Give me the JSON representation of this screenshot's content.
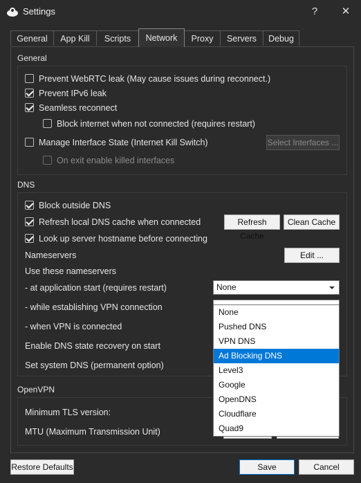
{
  "window": {
    "title": "Settings",
    "help_label": "?",
    "close_label": "✕"
  },
  "tabs": [
    {
      "label": "General"
    },
    {
      "label": "App Kill"
    },
    {
      "label": "Scripts"
    },
    {
      "label": "Network",
      "active": true
    },
    {
      "label": "Proxy"
    },
    {
      "label": "Servers"
    },
    {
      "label": "Debug"
    }
  ],
  "general": {
    "heading": "General",
    "prevent_webrtc": {
      "label": "Prevent WebRTC leak (May cause issues during reconnect.)",
      "checked": false
    },
    "prevent_ipv6": {
      "label": "Prevent IPv6 leak",
      "checked": true
    },
    "seamless_reconnect": {
      "label": "Seamless reconnect",
      "checked": true
    },
    "block_internet": {
      "label": "Block internet when not connected (requires restart)",
      "checked": false
    },
    "manage_interface": {
      "label": "Manage Interface State (Internet Kill Switch)",
      "checked": false
    },
    "select_interfaces_label": "Select Interfaces ...",
    "on_exit_enable": {
      "label": "On exit enable killed interfaces",
      "checked": false,
      "disabled": true
    }
  },
  "dns": {
    "heading": "DNS",
    "block_outside": {
      "label": "Block outside DNS",
      "checked": true
    },
    "refresh_cache": {
      "label": "Refresh local DNS cache when connected",
      "checked": true
    },
    "refresh_cache_button": "Refresh Cache",
    "clean_cache_button": "Clean Cache",
    "lookup_hostname": {
      "label": "Look up server hostname before connecting",
      "checked": true
    },
    "nameservers_label": "Nameservers",
    "edit_button": "Edit ...",
    "use_these_label": "Use these nameservers",
    "at_app_start_label": " - at application start (requires restart)",
    "at_app_start_value": "None",
    "while_establishing_label": " - while establishing VPN connection",
    "when_connected_label": " - when VPN is connected",
    "enable_recovery_label": "Enable DNS state recovery on start",
    "set_system_dns_label": "Set system DNS (permanent option)",
    "dropdown_options": [
      "None",
      "Pushed DNS",
      "VPN DNS",
      "Ad Blocking DNS",
      "Level3",
      "Google",
      "OpenDNS",
      "Cloudflare",
      "Quad9"
    ],
    "dropdown_selected": "Ad Blocking DNS"
  },
  "openvpn": {
    "heading": "OpenVPN",
    "min_tls_label": "Minimum TLS version:",
    "mtu_label": "MTU (Maximum Transmission Unit)"
  },
  "footer": {
    "restore_defaults": "Restore Defaults",
    "save": "Save",
    "cancel": "Cancel"
  },
  "colors": {
    "accent": "#0078d7",
    "background": "#2b2b2b"
  }
}
